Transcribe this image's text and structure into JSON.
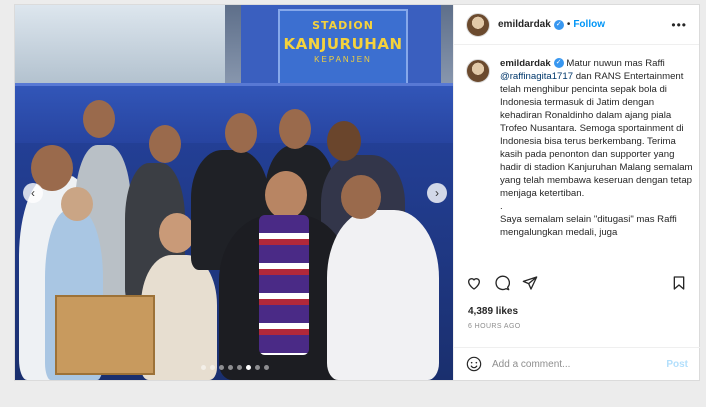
{
  "photo": {
    "sign_line1": "STADION",
    "sign_line2": "KANJURUHAN",
    "sign_line3": "KEPANJEN"
  },
  "header": {
    "username": "emildardak",
    "separator": "•",
    "follow_label": "Follow",
    "more_label": "•••"
  },
  "caption": {
    "username": "emildardak",
    "text_before_mention": "Matur nuwun mas Raffi",
    "mention": "@raffinagita1717",
    "text_after_mention": "dan RANS Entertainment telah menghibur pencinta sepak bola di Indonesia termasuk di Jatim dengan kehadiran Ronaldinho dalam ajang piala Trofeo Nusantara. Semoga sportainment di Indonesia bisa terus berkembang. Terima kasih pada penonton dan supporter yang hadir di stadion Kanjuruhan Malang semalam yang telah membawa keseruan dengan tetap menjaga ketertiban.",
    "line_break": ".",
    "continuation": "Saya semalam selain \"ditugasi\" mas Raffi mengalungkan medali, juga"
  },
  "likes": "4,389 likes",
  "time_ago": "6 HOURS AGO",
  "comment": {
    "placeholder": "Add a comment...",
    "post_label": "Post"
  },
  "colors": {
    "accent": "#0095f6",
    "verified": "#3897f0",
    "text": "#262626",
    "muted": "#8e8e8e"
  }
}
